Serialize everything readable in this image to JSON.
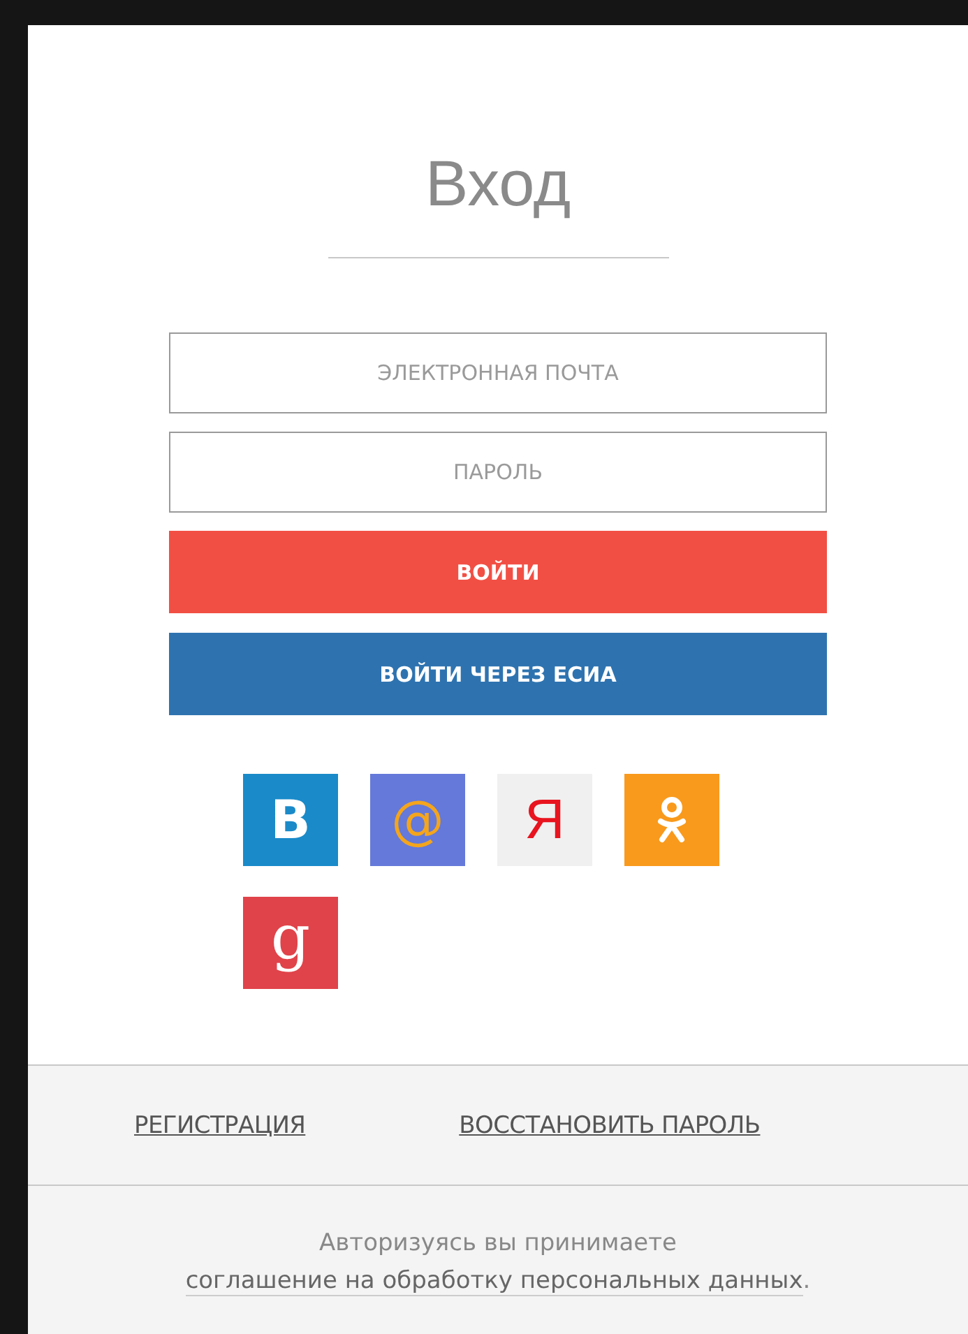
{
  "title": "Вход",
  "fields": [
    {
      "placeholder": "ЭЛЕКТРОННАЯ ПОЧТА"
    },
    {
      "placeholder": "ПАРОЛЬ"
    }
  ],
  "buttons": [
    {
      "label": "ВОЙТИ",
      "kind": "primary"
    },
    {
      "label": "ВОЙТИ ЧЕРЕЗ ЕСИА",
      "kind": "secondary"
    }
  ],
  "social": [
    {
      "kind": "vk",
      "glyph": "B",
      "color": "#1a8ac9"
    },
    {
      "kind": "mail",
      "glyph": "@",
      "color": "#6479d9"
    },
    {
      "kind": "yandex",
      "glyph": "Я",
      "color": "#f0f0f0"
    },
    {
      "kind": "ok",
      "color": "#f99a1c"
    },
    {
      "kind": "google",
      "glyph": "g",
      "color": "#e0434a"
    }
  ],
  "links": [
    "РЕГИСТРАЦИЯ",
    "ВОССТАНОВИТЬ ПАРОЛЬ"
  ],
  "consent": {
    "text": "Авторизуясь вы принимаете",
    "link": "соглашение на обработку персональных данных",
    "end": "."
  }
}
